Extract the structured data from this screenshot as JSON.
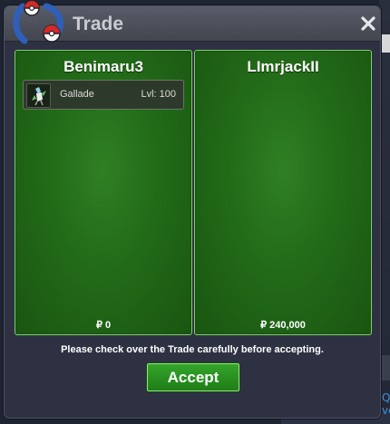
{
  "window": {
    "title": "Trade",
    "close_icon": "close-icon",
    "logo_icon": "pokeball-emblem-icon"
  },
  "left_panel": {
    "player_name": "Benimaru3",
    "pokemon": [
      {
        "name": "Gallade",
        "level_text": "Lvl: 100",
        "icon": "gallade-sprite-icon"
      }
    ],
    "money_symbol": "₽",
    "money": "0"
  },
  "right_panel": {
    "player_name": "LImrjackII",
    "pokemon": [],
    "money_symbol": "₽",
    "money": "240,000"
  },
  "notice": "Please check over the Trade carefully before accepting.",
  "accept_label": "Accept",
  "colors": {
    "panel_green": "#226a18",
    "panel_border": "#7fd36b",
    "button_green": "#2a9420",
    "window_bg": "#2d3142",
    "titlebar": "#4d5059"
  }
}
